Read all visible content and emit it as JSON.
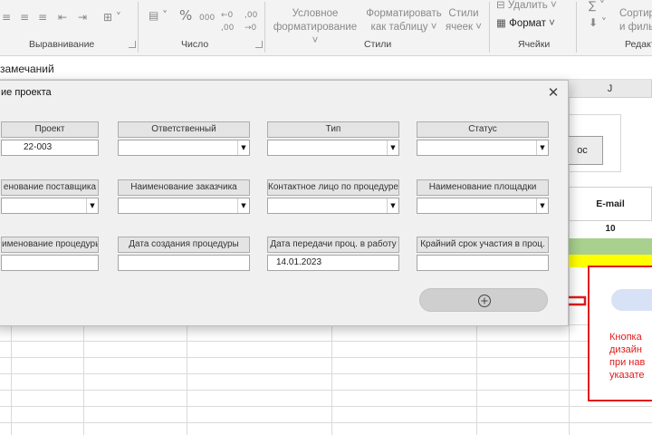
{
  "ribbon": {
    "groups": {
      "alignment": "Выравнивание",
      "number": "Число",
      "styles": "Стили",
      "cells": "Ячейки",
      "editing": "Редакти"
    },
    "conditional_formatting": [
      "Условное",
      "форматирование ˅"
    ],
    "format_as_table": [
      "Форматировать",
      "как таблицу ˅"
    ],
    "cell_styles": [
      "Стили",
      "ячеек ˅"
    ],
    "delete_label": "Удалить",
    "format_label": "Формат",
    "sort_label": [
      "Сортир",
      "и филь"
    ],
    "percent": "%",
    "thousands": "000"
  },
  "namebar": {
    "text": "замечаний"
  },
  "sheet": {
    "column_j": "J",
    "bg_button_label": "ос",
    "email_header": "E-mail",
    "email_value": "10"
  },
  "dialog": {
    "title": "ие проекта",
    "close_symbol": "✕",
    "fields": [
      {
        "label": "Проект",
        "value": "22-003",
        "dropdown": false
      },
      {
        "label": "Ответственный",
        "value": "",
        "dropdown": true
      },
      {
        "label": "Тип",
        "value": "",
        "dropdown": true
      },
      {
        "label": "Статус",
        "value": "",
        "dropdown": true
      },
      {
        "label": "енование поставщика",
        "value": "",
        "dropdown": true
      },
      {
        "label": "Наименование заказчика",
        "value": "",
        "dropdown": true
      },
      {
        "label": "Контактное лицо по процедуре",
        "value": "",
        "dropdown": true
      },
      {
        "label": "Наименование площадки",
        "value": "",
        "dropdown": true
      },
      {
        "label": "именование процедуры",
        "value": "",
        "dropdown": false
      },
      {
        "label": "Дата создания процедуры",
        "value": "",
        "dropdown": false
      },
      {
        "label": "Дата передачи проц. в работу",
        "value": "14.01.2023",
        "dropdown": false
      },
      {
        "label": "Крайний срок участия в проц.",
        "value": "",
        "dropdown": false
      }
    ],
    "add_icon": "plus-circle-icon"
  },
  "annotation": {
    "lines": [
      "Кнопка",
      "дизайн",
      "при нав",
      "указате"
    ],
    "color": "#e11a1a"
  }
}
